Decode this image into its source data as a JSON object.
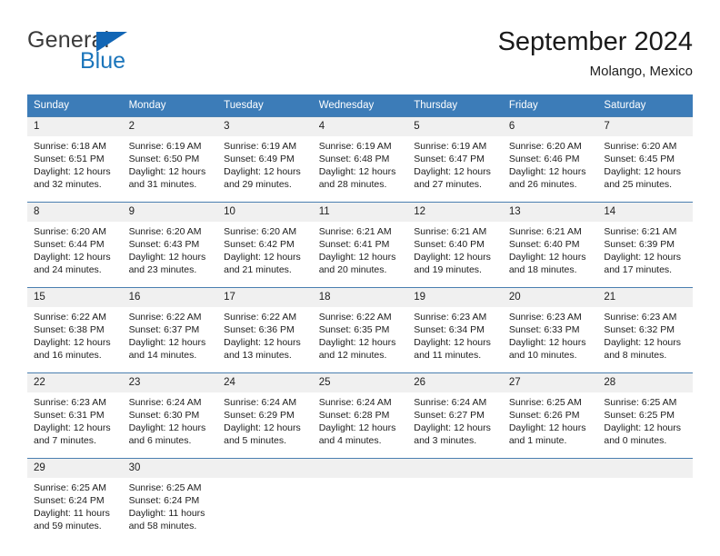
{
  "brand": {
    "name_top": "General",
    "name_bottom": "Blue",
    "accent_color": "#1b75bb",
    "triangle_color": "#1266b5"
  },
  "header": {
    "title": "September 2024",
    "subtitle": "Molango, Mexico"
  },
  "theme": {
    "header_row_bg": "#3c7cb8",
    "header_row_text": "#ffffff",
    "daynum_bg": "#f0f0f0",
    "row_border": "#4a7fb0",
    "body_text": "#1c1c1c"
  },
  "weekday_headers": [
    "Sunday",
    "Monday",
    "Tuesday",
    "Wednesday",
    "Thursday",
    "Friday",
    "Saturday"
  ],
  "labels": {
    "sunrise_prefix": "Sunrise:",
    "sunset_prefix": "Sunset:",
    "daylight_prefix": "Daylight:"
  },
  "weeks": [
    {
      "days": [
        {
          "num": "1",
          "sunrise": "Sunrise: 6:18 AM",
          "sunset": "Sunset: 6:51 PM",
          "daylight1": "Daylight: 12 hours",
          "daylight2": "and 32 minutes."
        },
        {
          "num": "2",
          "sunrise": "Sunrise: 6:19 AM",
          "sunset": "Sunset: 6:50 PM",
          "daylight1": "Daylight: 12 hours",
          "daylight2": "and 31 minutes."
        },
        {
          "num": "3",
          "sunrise": "Sunrise: 6:19 AM",
          "sunset": "Sunset: 6:49 PM",
          "daylight1": "Daylight: 12 hours",
          "daylight2": "and 29 minutes."
        },
        {
          "num": "4",
          "sunrise": "Sunrise: 6:19 AM",
          "sunset": "Sunset: 6:48 PM",
          "daylight1": "Daylight: 12 hours",
          "daylight2": "and 28 minutes."
        },
        {
          "num": "5",
          "sunrise": "Sunrise: 6:19 AM",
          "sunset": "Sunset: 6:47 PM",
          "daylight1": "Daylight: 12 hours",
          "daylight2": "and 27 minutes."
        },
        {
          "num": "6",
          "sunrise": "Sunrise: 6:20 AM",
          "sunset": "Sunset: 6:46 PM",
          "daylight1": "Daylight: 12 hours",
          "daylight2": "and 26 minutes."
        },
        {
          "num": "7",
          "sunrise": "Sunrise: 6:20 AM",
          "sunset": "Sunset: 6:45 PM",
          "daylight1": "Daylight: 12 hours",
          "daylight2": "and 25 minutes."
        }
      ]
    },
    {
      "days": [
        {
          "num": "8",
          "sunrise": "Sunrise: 6:20 AM",
          "sunset": "Sunset: 6:44 PM",
          "daylight1": "Daylight: 12 hours",
          "daylight2": "and 24 minutes."
        },
        {
          "num": "9",
          "sunrise": "Sunrise: 6:20 AM",
          "sunset": "Sunset: 6:43 PM",
          "daylight1": "Daylight: 12 hours",
          "daylight2": "and 23 minutes."
        },
        {
          "num": "10",
          "sunrise": "Sunrise: 6:20 AM",
          "sunset": "Sunset: 6:42 PM",
          "daylight1": "Daylight: 12 hours",
          "daylight2": "and 21 minutes."
        },
        {
          "num": "11",
          "sunrise": "Sunrise: 6:21 AM",
          "sunset": "Sunset: 6:41 PM",
          "daylight1": "Daylight: 12 hours",
          "daylight2": "and 20 minutes."
        },
        {
          "num": "12",
          "sunrise": "Sunrise: 6:21 AM",
          "sunset": "Sunset: 6:40 PM",
          "daylight1": "Daylight: 12 hours",
          "daylight2": "and 19 minutes."
        },
        {
          "num": "13",
          "sunrise": "Sunrise: 6:21 AM",
          "sunset": "Sunset: 6:40 PM",
          "daylight1": "Daylight: 12 hours",
          "daylight2": "and 18 minutes."
        },
        {
          "num": "14",
          "sunrise": "Sunrise: 6:21 AM",
          "sunset": "Sunset: 6:39 PM",
          "daylight1": "Daylight: 12 hours",
          "daylight2": "and 17 minutes."
        }
      ]
    },
    {
      "days": [
        {
          "num": "15",
          "sunrise": "Sunrise: 6:22 AM",
          "sunset": "Sunset: 6:38 PM",
          "daylight1": "Daylight: 12 hours",
          "daylight2": "and 16 minutes."
        },
        {
          "num": "16",
          "sunrise": "Sunrise: 6:22 AM",
          "sunset": "Sunset: 6:37 PM",
          "daylight1": "Daylight: 12 hours",
          "daylight2": "and 14 minutes."
        },
        {
          "num": "17",
          "sunrise": "Sunrise: 6:22 AM",
          "sunset": "Sunset: 6:36 PM",
          "daylight1": "Daylight: 12 hours",
          "daylight2": "and 13 minutes."
        },
        {
          "num": "18",
          "sunrise": "Sunrise: 6:22 AM",
          "sunset": "Sunset: 6:35 PM",
          "daylight1": "Daylight: 12 hours",
          "daylight2": "and 12 minutes."
        },
        {
          "num": "19",
          "sunrise": "Sunrise: 6:23 AM",
          "sunset": "Sunset: 6:34 PM",
          "daylight1": "Daylight: 12 hours",
          "daylight2": "and 11 minutes."
        },
        {
          "num": "20",
          "sunrise": "Sunrise: 6:23 AM",
          "sunset": "Sunset: 6:33 PM",
          "daylight1": "Daylight: 12 hours",
          "daylight2": "and 10 minutes."
        },
        {
          "num": "21",
          "sunrise": "Sunrise: 6:23 AM",
          "sunset": "Sunset: 6:32 PM",
          "daylight1": "Daylight: 12 hours",
          "daylight2": "and 8 minutes."
        }
      ]
    },
    {
      "days": [
        {
          "num": "22",
          "sunrise": "Sunrise: 6:23 AM",
          "sunset": "Sunset: 6:31 PM",
          "daylight1": "Daylight: 12 hours",
          "daylight2": "and 7 minutes."
        },
        {
          "num": "23",
          "sunrise": "Sunrise: 6:24 AM",
          "sunset": "Sunset: 6:30 PM",
          "daylight1": "Daylight: 12 hours",
          "daylight2": "and 6 minutes."
        },
        {
          "num": "24",
          "sunrise": "Sunrise: 6:24 AM",
          "sunset": "Sunset: 6:29 PM",
          "daylight1": "Daylight: 12 hours",
          "daylight2": "and 5 minutes."
        },
        {
          "num": "25",
          "sunrise": "Sunrise: 6:24 AM",
          "sunset": "Sunset: 6:28 PM",
          "daylight1": "Daylight: 12 hours",
          "daylight2": "and 4 minutes."
        },
        {
          "num": "26",
          "sunrise": "Sunrise: 6:24 AM",
          "sunset": "Sunset: 6:27 PM",
          "daylight1": "Daylight: 12 hours",
          "daylight2": "and 3 minutes."
        },
        {
          "num": "27",
          "sunrise": "Sunrise: 6:25 AM",
          "sunset": "Sunset: 6:26 PM",
          "daylight1": "Daylight: 12 hours",
          "daylight2": "and 1 minute."
        },
        {
          "num": "28",
          "sunrise": "Sunrise: 6:25 AM",
          "sunset": "Sunset: 6:25 PM",
          "daylight1": "Daylight: 12 hours",
          "daylight2": "and 0 minutes."
        }
      ]
    },
    {
      "days": [
        {
          "num": "29",
          "sunrise": "Sunrise: 6:25 AM",
          "sunset": "Sunset: 6:24 PM",
          "daylight1": "Daylight: 11 hours",
          "daylight2": "and 59 minutes."
        },
        {
          "num": "30",
          "sunrise": "Sunrise: 6:25 AM",
          "sunset": "Sunset: 6:24 PM",
          "daylight1": "Daylight: 11 hours",
          "daylight2": "and 58 minutes."
        },
        {
          "num": "",
          "sunrise": "",
          "sunset": "",
          "daylight1": "",
          "daylight2": ""
        },
        {
          "num": "",
          "sunrise": "",
          "sunset": "",
          "daylight1": "",
          "daylight2": ""
        },
        {
          "num": "",
          "sunrise": "",
          "sunset": "",
          "daylight1": "",
          "daylight2": ""
        },
        {
          "num": "",
          "sunrise": "",
          "sunset": "",
          "daylight1": "",
          "daylight2": ""
        },
        {
          "num": "",
          "sunrise": "",
          "sunset": "",
          "daylight1": "",
          "daylight2": ""
        }
      ]
    }
  ]
}
